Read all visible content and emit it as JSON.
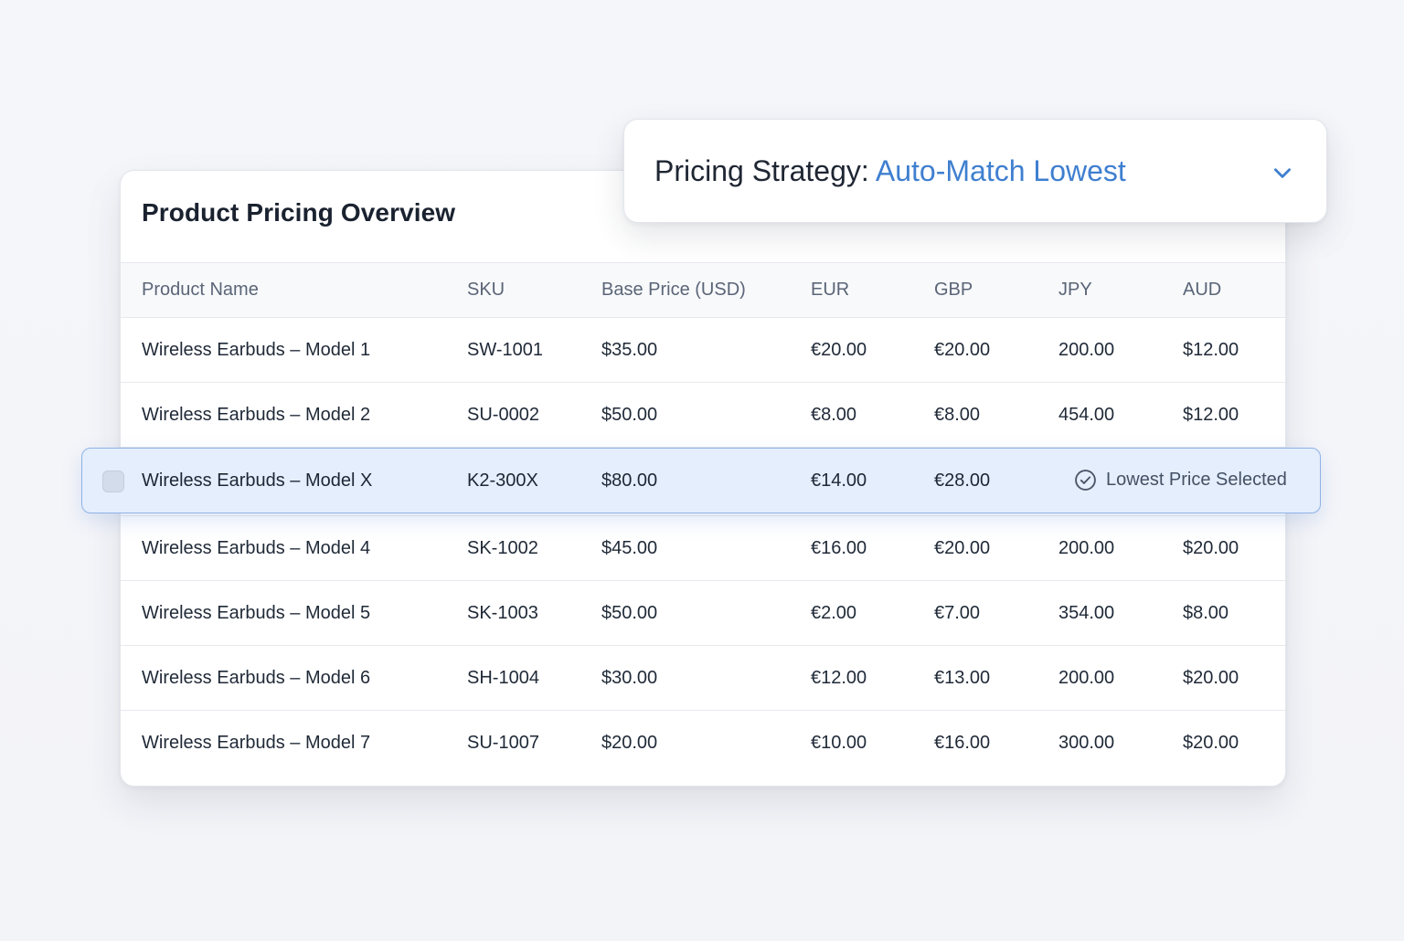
{
  "card": {
    "title": "Product Pricing Overview"
  },
  "table": {
    "columns": [
      "Product Name",
      "SKU",
      "Base Price (USD)",
      "EUR",
      "GBP",
      "JPY",
      "AUD"
    ],
    "rows": [
      [
        "Wireless Earbuds – Model 1",
        "SW-1001",
        "$35.00",
        "€20.00",
        "€20.00",
        "200.00",
        "$12.00"
      ],
      [
        "Wireless Earbuds – Model 2",
        "SU-0002",
        "$50.00",
        "€8.00",
        "€8.00",
        "454.00",
        "$12.00"
      ],
      [
        "Wireless Earbuds – Model 4",
        "SK-1002",
        "$45.00",
        "€16.00",
        "€20.00",
        "200.00",
        "$20.00"
      ],
      [
        "Wireless Earbuds – Model 5",
        "SK-1003",
        "$50.00",
        "€2.00",
        "€7.00",
        "354.00",
        "$8.00"
      ],
      [
        "Wireless Earbuds – Model 6",
        "SH-1004",
        "$30.00",
        "€12.00",
        "€13.00",
        "200.00",
        "$20.00"
      ],
      [
        "Wireless Earbuds – Model 7",
        "SU-1007",
        "$20.00",
        "€10.00",
        "€16.00",
        "300.00",
        "$20.00"
      ]
    ]
  },
  "highlighted_row": {
    "name": "Wireless Earbuds – Model X",
    "sku": "K2-300X",
    "base": "$80.00",
    "eur": "€14.00",
    "gbp": "€28.00",
    "badge": "Lowest Price Selected",
    "badge_icon": "check-circle-icon"
  },
  "strategy": {
    "label": "Pricing Strategy:",
    "value": "Auto-Match Lowest",
    "icon": "chevron-down-icon"
  },
  "colors": {
    "accent": "#3f7fd0",
    "highlight_bg": "#e4eefc",
    "highlight_border": "#8fb2e6"
  }
}
